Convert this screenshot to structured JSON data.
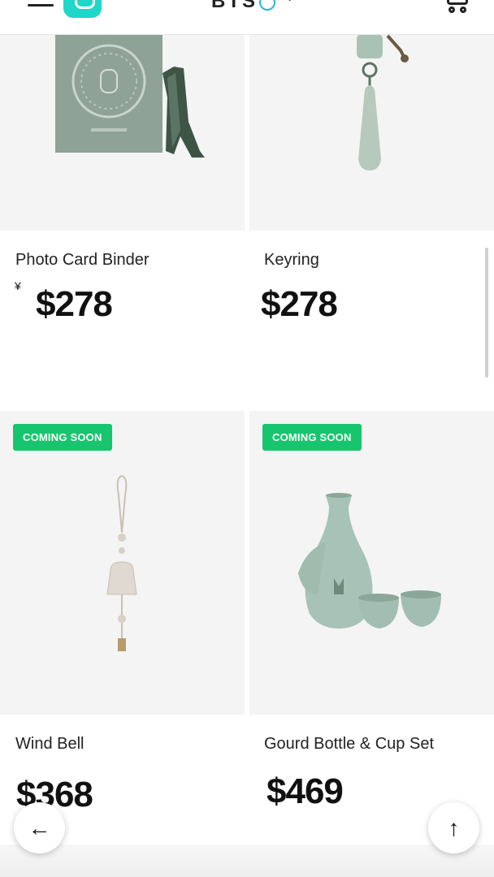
{
  "header": {
    "brand": "BTS",
    "menu_icon": "hamburger-menu-icon",
    "shop_icon": "shopping-bag-icon",
    "brand_icon": "globe-icon",
    "dropdown_icon": "chevron-down-icon",
    "cart_icon": "cart-icon"
  },
  "products": [
    {
      "name": "Photo Card Binder",
      "price": "$278",
      "badge": "",
      "mark": "¥"
    },
    {
      "name": "Keyring",
      "price": "$278",
      "badge": ""
    },
    {
      "name": "Wind Bell",
      "price": "$368",
      "badge": "COMING SOON"
    },
    {
      "name": "Gourd Bottle & Cup Set",
      "price": "$469",
      "badge": "COMING SOON"
    }
  ],
  "colors": {
    "badge_green": "#17c56e",
    "brand_teal": "#1fd6c8",
    "product_sage": "#8fa89a"
  },
  "floating": {
    "back_icon": "arrow-left-icon",
    "top_icon": "arrow-up-icon",
    "back_glyph": "←",
    "top_glyph": "↑"
  }
}
